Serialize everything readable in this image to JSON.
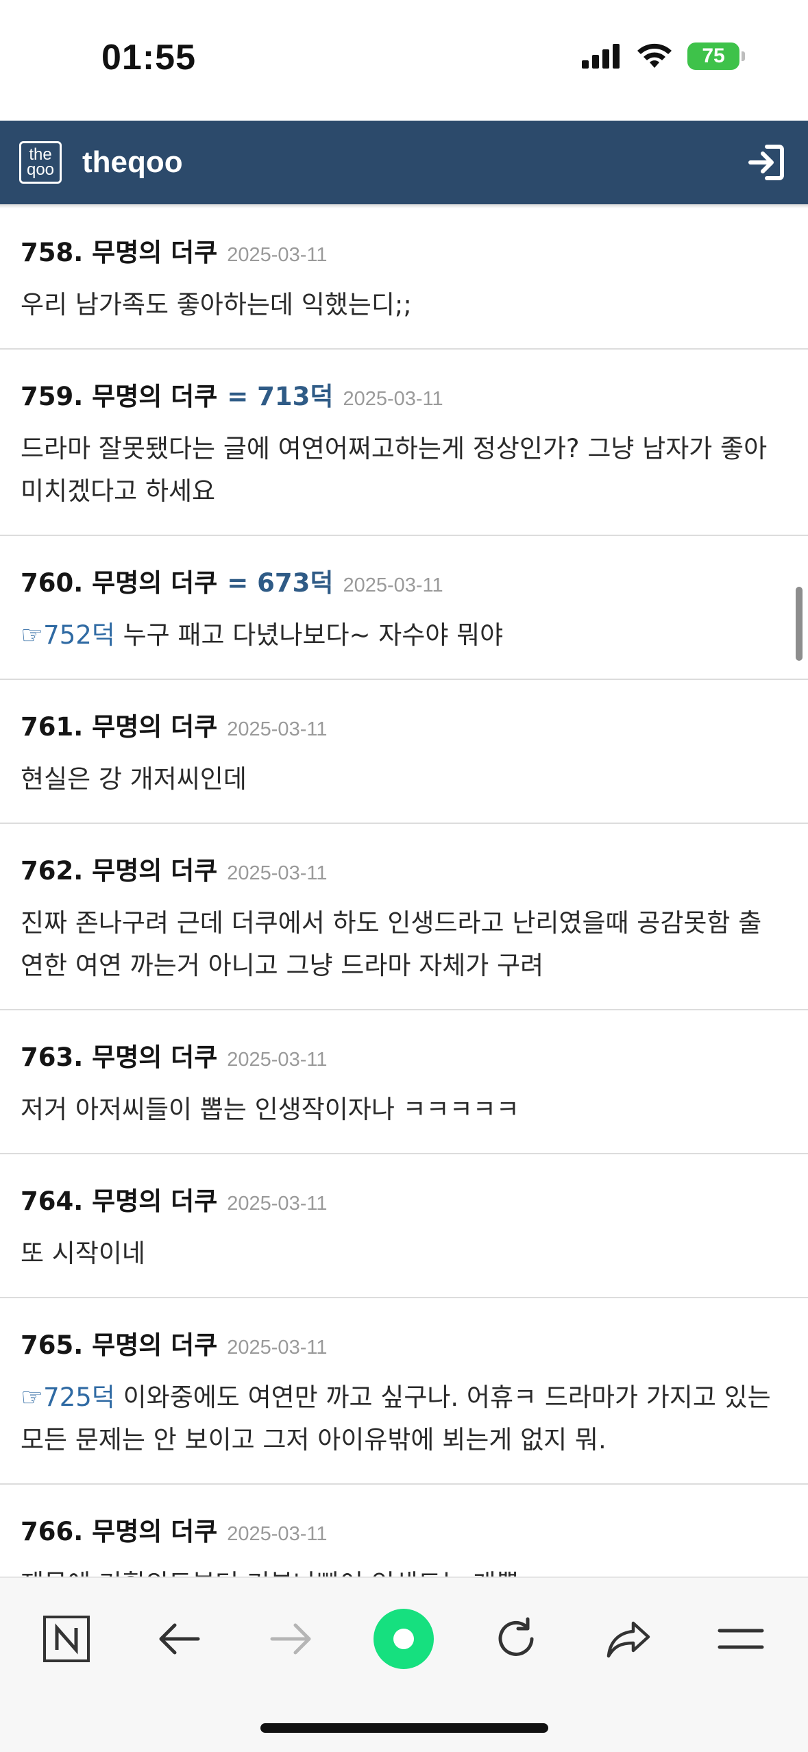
{
  "status": {
    "time": "01:55",
    "battery": "75"
  },
  "header": {
    "logo_top": "the",
    "logo_bottom": "qoo",
    "title": "theqoo"
  },
  "comments": [
    {
      "num_author": "758. 무명의 더쿠",
      "ref": "",
      "date": "2025-03-11",
      "quote": "",
      "lines": [
        "우리 남가족도 좋아하는데 익했는디;;"
      ]
    },
    {
      "num_author": "759. 무명의 더쿠",
      "ref": "= 713덕",
      "date": "2025-03-11",
      "quote": "",
      "lines": [
        "드라마 잘못됐다는 글에 여연어쩌고하는게 정상인가? 그냥 남자가 좋아",
        "미치겠다고 하세요"
      ]
    },
    {
      "num_author": "760. 무명의 더쿠",
      "ref": "= 673덕",
      "date": "2025-03-11",
      "quote": "☞752덕",
      "lines": [
        "누구 패고 다녔나보다~ 자수야 뭐야"
      ]
    },
    {
      "num_author": "761. 무명의 더쿠",
      "ref": "",
      "date": "2025-03-11",
      "quote": "",
      "lines": [
        "현실은 강 개저씨인데"
      ]
    },
    {
      "num_author": "762. 무명의 더쿠",
      "ref": "",
      "date": "2025-03-11",
      "quote": "",
      "lines": [
        "진짜 존나구려 근데 더쿠에서 하도 인생드라고 난리였을때 공감못함 출",
        "연한 여연 까는거 아니고 그냥 드라마 자체가 구려"
      ]
    },
    {
      "num_author": "763. 무명의 더쿠",
      "ref": "",
      "date": "2025-03-11",
      "quote": "",
      "lines": [
        "저거 아저씨들이 뽑는 인생작이자나 ㅋㅋㅋㅋㅋ"
      ]
    },
    {
      "num_author": "764. 무명의 더쿠",
      "ref": "",
      "date": "2025-03-11",
      "quote": "",
      "lines": [
        "또 시작이네"
      ]
    },
    {
      "num_author": "765. 무명의 더쿠",
      "ref": "",
      "date": "2025-03-11",
      "quote": "☞725덕",
      "lines": [
        "이와중에도 여연만 까고 싶구나. 어휴ㅋ 드라마가 가지고 있는",
        "모든 문제는 안 보이고 그저 아이유밖에 뵈는게 없지 뭐."
      ]
    },
    {
      "num_author": "766. 무명의 더쿠",
      "ref": "",
      "date": "2025-03-11",
      "quote": "",
      "lines": [
        "제목에 기획의도부터 기분나빴어 인생드는 개뿔"
      ]
    }
  ],
  "icons": {
    "login": "sign-in-icon",
    "nav": [
      "naver-n-icon",
      "back-arrow-icon",
      "forward-arrow-icon",
      "home-dot-icon",
      "reload-icon",
      "share-icon",
      "menu-icon"
    ]
  },
  "colors": {
    "header_bg": "#2c4a6b",
    "ref_text": "#2f5b86",
    "quote_text": "#2f6aa3",
    "accent_green": "#16e07f"
  }
}
